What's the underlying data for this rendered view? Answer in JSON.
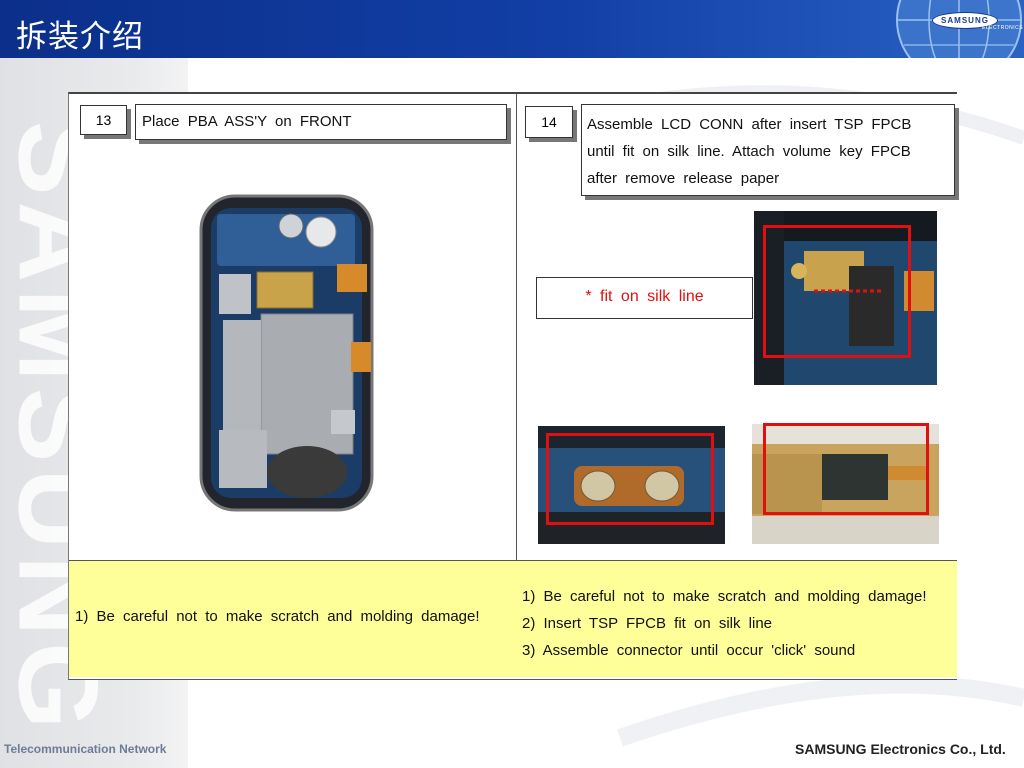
{
  "header": {
    "title": "拆装介绍",
    "logo_text": "SAMSUNG",
    "logo_sub": "ELECTRONICS"
  },
  "watermark": {
    "text": "SAMSUNG"
  },
  "step13": {
    "number": "13",
    "title": "Place PBA ASS'Y on FRONT"
  },
  "step14": {
    "number": "14",
    "lines": [
      "Assemble LCD CONN after insert TSP FPCB",
      "until fit on silk line. Attach volume key FPCB",
      "after remove release paper"
    ],
    "callout": "* fit on silk line"
  },
  "notes13": [
    "1) Be careful not to make scratch and molding damage!"
  ],
  "notes14": [
    "1) Be careful not to make scratch and molding damage!",
    "2) Insert TSP FPCB fit on silk line",
    "3) Assemble connector until occur 'click' sound"
  ],
  "footer": {
    "left": "Telecommunication Network",
    "right": "SAMSUNG Electronics Co., Ltd."
  },
  "colors": {
    "header_blue": "#123fa6",
    "note_yellow": "#ffff99",
    "highlight_red": "#e01010"
  }
}
